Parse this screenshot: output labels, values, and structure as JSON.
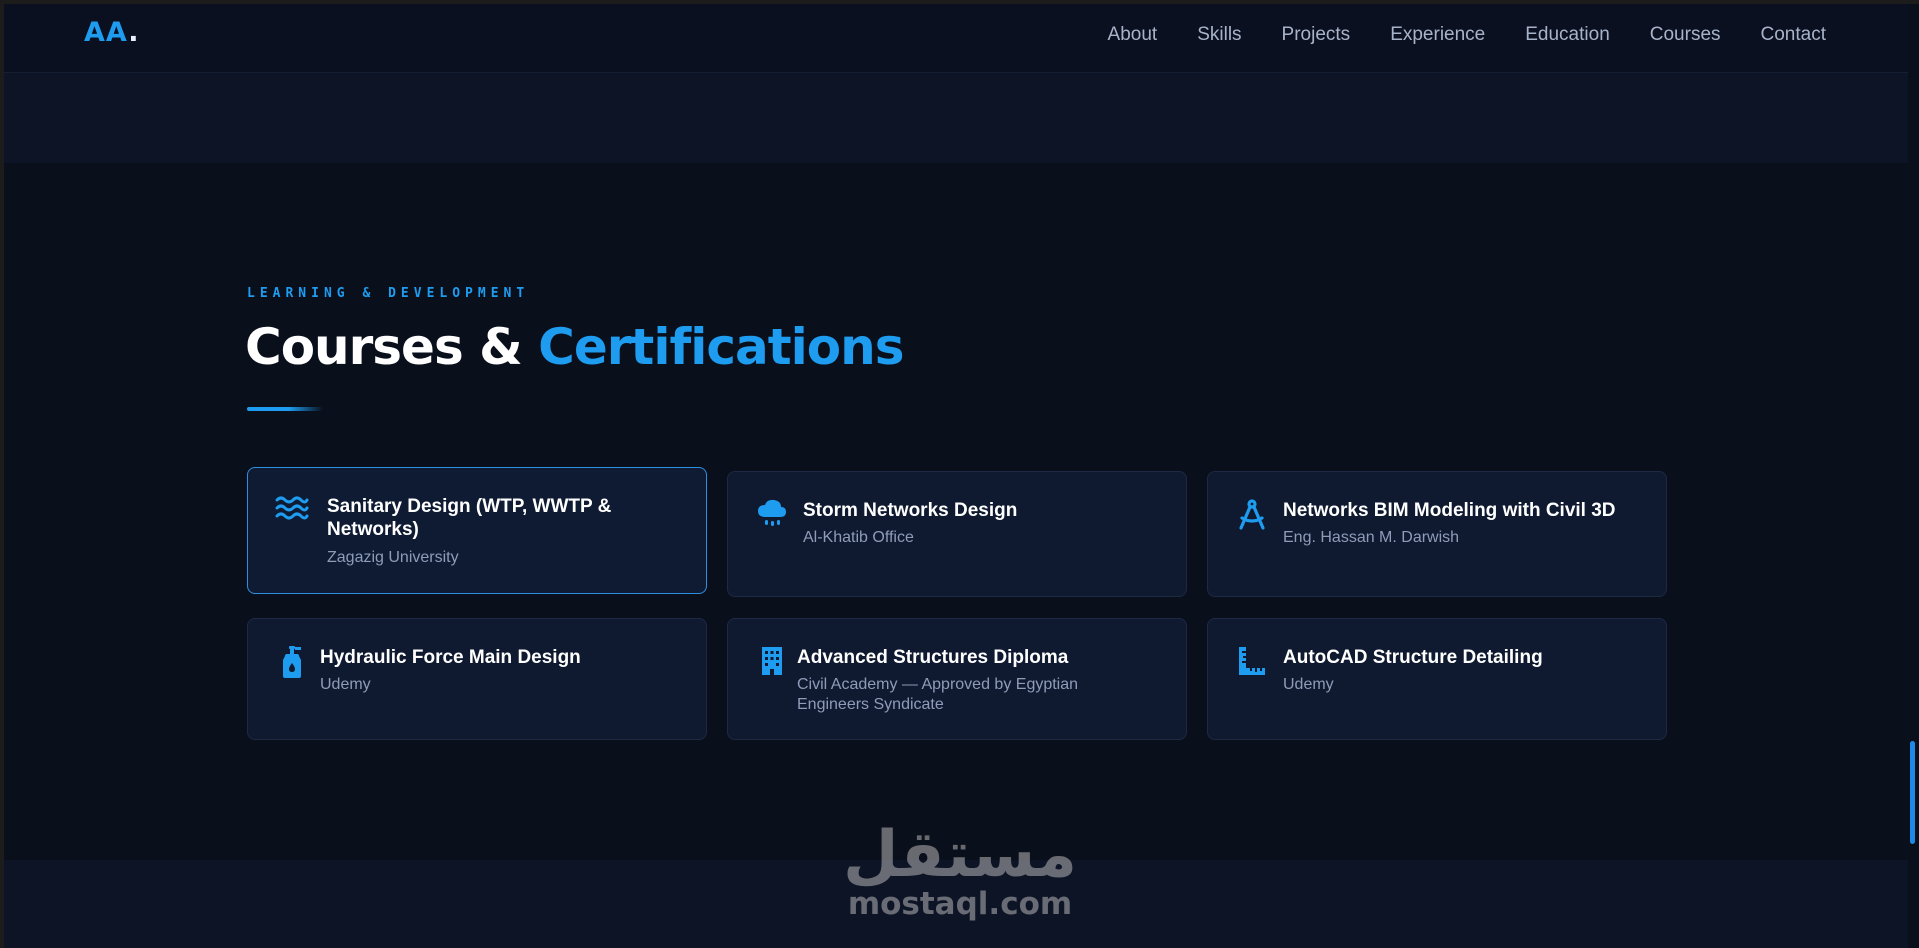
{
  "nav": {
    "logo": "AA",
    "logo_dot": ".",
    "links": [
      "About",
      "Skills",
      "Projects",
      "Experience",
      "Education",
      "Courses",
      "Contact"
    ]
  },
  "section": {
    "eyebrow": "LEARNING & DEVELOPMENT",
    "title_main": "Courses & ",
    "title_accent": "Certifications"
  },
  "courses": [
    {
      "title": "Sanitary Design (WTP, WWTP & Networks)",
      "provider": "Zagazig University",
      "icon": "water-waves-icon",
      "active": true
    },
    {
      "title": "Storm Networks Design",
      "provider": "Al-Khatib Office",
      "icon": "cloud-rain-icon"
    },
    {
      "title": "Networks BIM Modeling with Civil 3D",
      "provider": "Eng. Hassan M. Darwish",
      "icon": "drafting-compass-icon"
    },
    {
      "title": "Hydraulic Force Main Design",
      "provider": "Udemy",
      "icon": "pump-bottle-icon"
    },
    {
      "title": "Advanced Structures Diploma",
      "provider": "Civil Academy — Approved by Egyptian Engineers Syndicate",
      "icon": "building-icon"
    },
    {
      "title": "AutoCAD Structure Detailing",
      "provider": "Udemy",
      "icon": "ruler-icon"
    }
  ],
  "watermark": {
    "arabic": "مستقل",
    "latin": "mostaql.com"
  },
  "colors": {
    "accent": "#1e9cf0",
    "background": "#0a0f1c",
    "card": "#0f1a30"
  }
}
